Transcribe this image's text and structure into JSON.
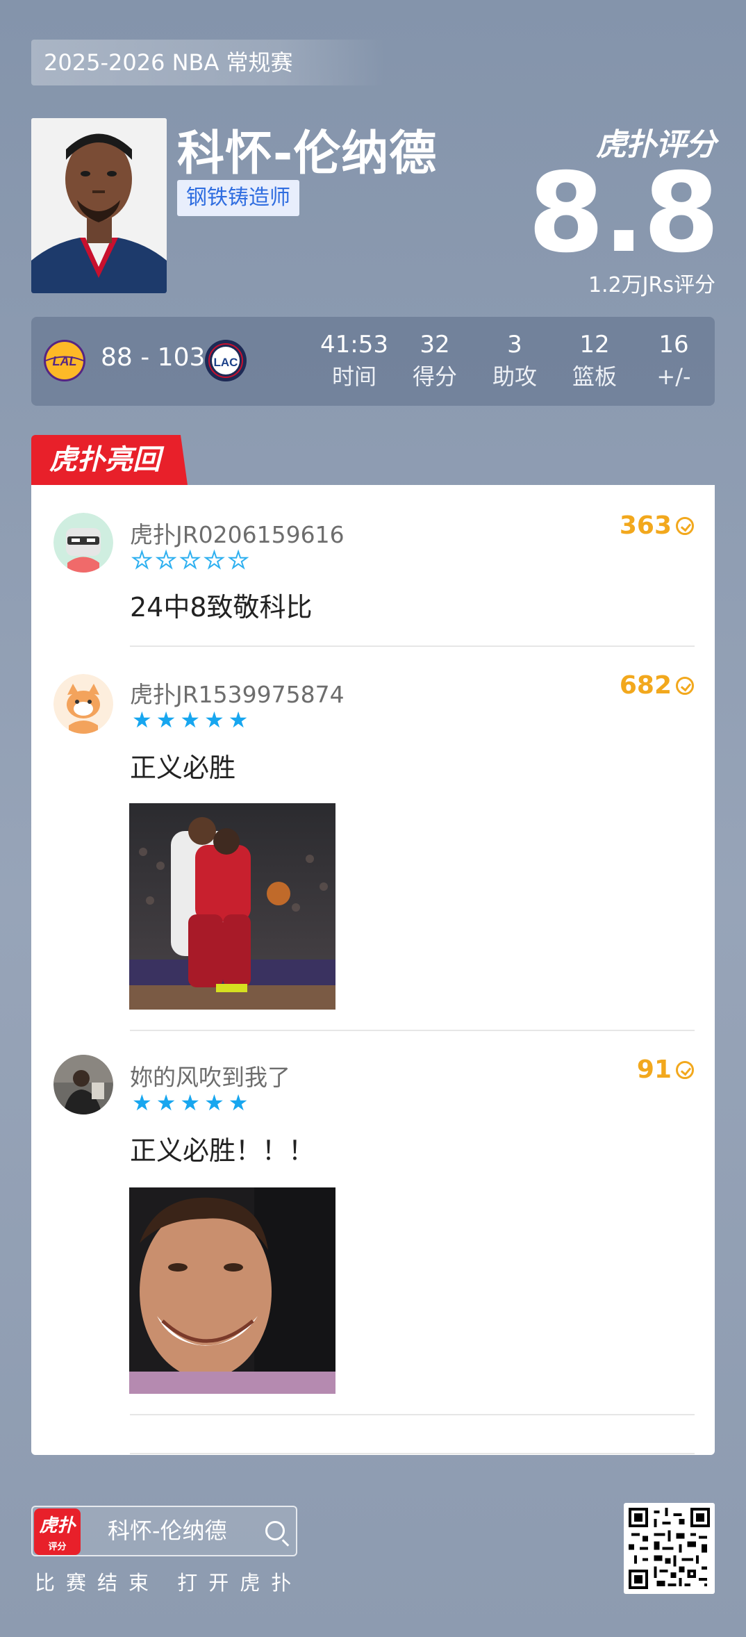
{
  "season": "2025-2026 NBA 常规赛",
  "player": {
    "name": "科怀-伦纳德",
    "tag": "钢铁铸造师"
  },
  "rating": {
    "brand": "虎扑评分",
    "score": "8.8",
    "count_label": "1.2万JRs评分"
  },
  "game": {
    "home_team_icon": "lakers-logo-icon",
    "away_team_icon": "clippers-logo-icon",
    "score": "88 - 103",
    "stats": [
      {
        "value": "41:53",
        "label": "时间"
      },
      {
        "value": "32",
        "label": "得分"
      },
      {
        "value": "3",
        "label": "助攻"
      },
      {
        "value": "12",
        "label": "篮板"
      },
      {
        "value": "16",
        "label": "+/-"
      }
    ]
  },
  "section_title": "虎扑亮回复",
  "comments": [
    {
      "user": "虎扑JR0206159616",
      "stars": 0,
      "text": "24中8致敬科比",
      "likes": "363",
      "avatar_icon": "robot-avatar-icon"
    },
    {
      "user": "虎扑JR1539975874",
      "stars": 5,
      "text": "正义必胜",
      "likes": "682",
      "avatar_icon": "cat-avatar-icon",
      "image": "basketball-game-gif"
    },
    {
      "user": "妳的风吹到我了",
      "stars": 5,
      "text": "正义必胜！！！",
      "likes": "91",
      "avatar_icon": "user-photo-avatar",
      "image": "laughing-player-gif"
    }
  ],
  "footer": {
    "search_text": "科怀-伦纳德",
    "app_icon_label": "虎扑",
    "app_icon_sub": "评分",
    "caption": "比赛结束 打开虎扑"
  },
  "colors": {
    "accent_red": "#e8202a",
    "likes_orange": "#f2a81d",
    "star_blue": "#17a6ef",
    "tag_blue": "#2f6de0"
  }
}
